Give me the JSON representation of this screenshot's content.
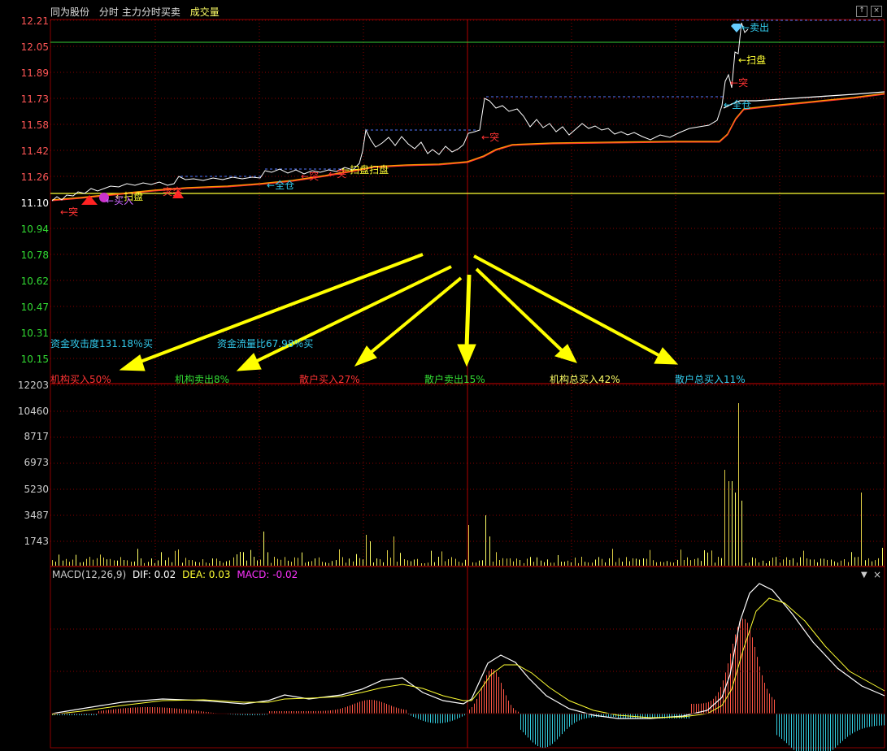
{
  "header": {
    "stock_name": "同为股份",
    "tab_timeshare": "分时",
    "tab_main_force": "主力分时买卖",
    "tab_volume": "成交量"
  },
  "price_axis": [
    "12.21",
    "12.05",
    "11.89",
    "11.73",
    "11.58",
    "11.42",
    "11.26",
    "11.10",
    "10.94",
    "10.78",
    "10.62",
    "10.47",
    "10.31",
    "10.15"
  ],
  "volume_axis": [
    "12203",
    "10460",
    "8717",
    "6973",
    "5230",
    "3487",
    "1743"
  ],
  "signals": {
    "sell": "卖出",
    "sweep1": "扫盘",
    "sweep2": "扫盘",
    "sweep3": "扫盘",
    "sweep4": "扫盘",
    "breakout1": "突",
    "breakout2": "突",
    "breakout3": "突",
    "breakout4": "突",
    "breakout5": "突",
    "full_position1": "全仓",
    "full_position2": "全仓",
    "buy_in": "买入"
  },
  "stats": {
    "attack_strength": "资金攻击度131.18％买",
    "flow_ratio": "资金流量比67.98％买",
    "inst_buy": "机构买入50%",
    "inst_sell": "机构卖出8%",
    "retail_buy": "散户买入27%",
    "retail_sell": "散户卖出15%",
    "inst_total_buy": "机构总买入42%",
    "retail_total_buy": "散户总买入11%"
  },
  "macd": {
    "name": "MACD(12,26,9)",
    "dif": "DIF: 0.02",
    "dea": "DEA: 0.03",
    "macd": "MACD: -0.02"
  },
  "colors": {
    "price_line": "#ffffff",
    "avg_line": "#ff9900",
    "grid": "#8b0000",
    "up_label": "#ff3333",
    "down_label": "#33cc33",
    "arrow": "#ffff00",
    "cyan": "#33ccee"
  }
}
